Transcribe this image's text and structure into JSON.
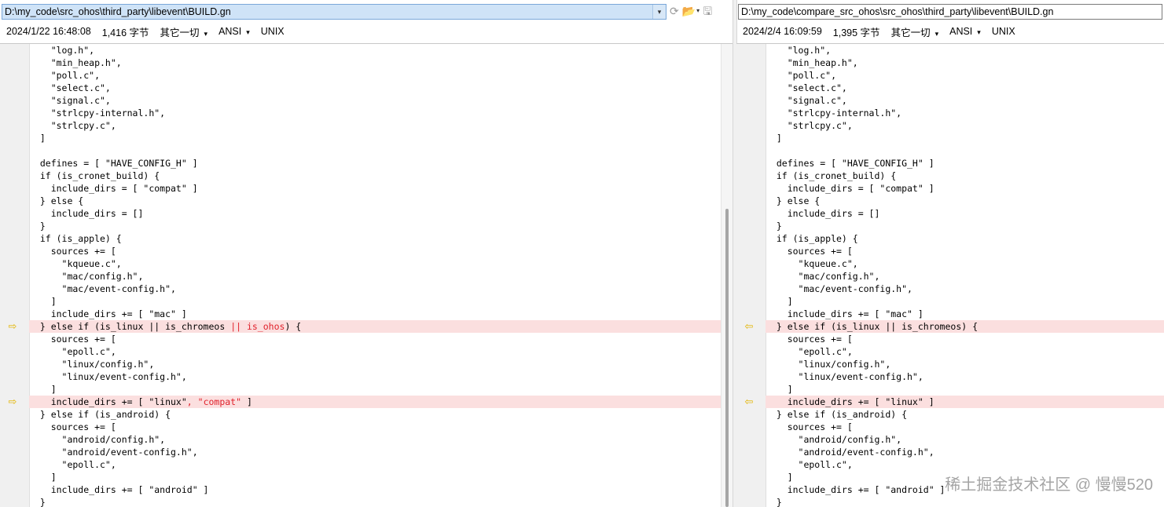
{
  "left": {
    "path": "D:\\my_code\\src_ohos\\third_party\\libevent\\BUILD.gn",
    "date": "2024/1/22 16:48:08",
    "size": "1,416 字节",
    "filter": "其它一切",
    "encoding": "ANSI",
    "line_ending": "UNIX"
  },
  "right": {
    "path": "D:\\my_code\\compare_src_ohos\\src_ohos\\third_party\\libevent\\BUILD.gn",
    "date": "2024/2/4 16:09:59",
    "size": "1,395 字节",
    "filter": "其它一切",
    "encoding": "ANSI",
    "line_ending": "UNIX"
  },
  "icons": {
    "dropdown": "▾",
    "reload": "⟳",
    "open_folder": "📂",
    "save": "🖫",
    "marker_right": "⇨",
    "marker_left": "⇦"
  },
  "watermark": "稀土掘金技术社区 @ 慢慢520",
  "left_lines": [
    {
      "segs": [
        {
          "t": "    \"log.h\","
        }
      ]
    },
    {
      "segs": [
        {
          "t": "    \"min_heap.h\","
        }
      ]
    },
    {
      "segs": [
        {
          "t": "    \"poll.c\","
        }
      ]
    },
    {
      "segs": [
        {
          "t": "    \"select.c\","
        }
      ]
    },
    {
      "segs": [
        {
          "t": "    \"signal.c\","
        }
      ]
    },
    {
      "segs": [
        {
          "t": "    \"strlcpy-internal.h\","
        }
      ]
    },
    {
      "segs": [
        {
          "t": "    \"strlcpy.c\","
        }
      ]
    },
    {
      "segs": [
        {
          "t": "  ]"
        }
      ]
    },
    {
      "segs": [
        {
          "t": ""
        }
      ]
    },
    {
      "segs": [
        {
          "t": "  defines = [ \"HAVE_CONFIG_H\" ]"
        }
      ]
    },
    {
      "segs": [
        {
          "t": "  if (is_cronet_build) {"
        }
      ]
    },
    {
      "segs": [
        {
          "t": "    include_dirs = [ \"compat\" ]"
        }
      ]
    },
    {
      "segs": [
        {
          "t": "  } else {"
        }
      ]
    },
    {
      "segs": [
        {
          "t": "    include_dirs = []"
        }
      ]
    },
    {
      "segs": [
        {
          "t": "  }"
        }
      ]
    },
    {
      "segs": [
        {
          "t": "  if (is_apple) {"
        }
      ]
    },
    {
      "segs": [
        {
          "t": "    sources += ["
        }
      ]
    },
    {
      "segs": [
        {
          "t": "      \"kqueue.c\","
        }
      ]
    },
    {
      "segs": [
        {
          "t": "      \"mac/config.h\","
        }
      ]
    },
    {
      "segs": [
        {
          "t": "      \"mac/event-config.h\","
        }
      ]
    },
    {
      "segs": [
        {
          "t": "    ]"
        }
      ]
    },
    {
      "segs": [
        {
          "t": "    include_dirs += [ \"mac\" ]"
        }
      ]
    },
    {
      "diff": true,
      "segs": [
        {
          "t": "  } else if (is_linux || is_chromeos "
        },
        {
          "t": "|| is_ohos",
          "hl": true
        },
        {
          "t": ") {"
        }
      ]
    },
    {
      "segs": [
        {
          "t": "    sources += ["
        }
      ]
    },
    {
      "segs": [
        {
          "t": "      \"epoll.c\","
        }
      ]
    },
    {
      "segs": [
        {
          "t": "      \"linux/config.h\","
        }
      ]
    },
    {
      "segs": [
        {
          "t": "      \"linux/event-config.h\","
        }
      ]
    },
    {
      "segs": [
        {
          "t": "    ]"
        }
      ]
    },
    {
      "diff": true,
      "segs": [
        {
          "t": "    include_dirs += [ \"linux\""
        },
        {
          "t": ", \"compat\"",
          "hl": true
        },
        {
          "t": " ]"
        }
      ]
    },
    {
      "segs": [
        {
          "t": "  } else if (is_android) {"
        }
      ]
    },
    {
      "segs": [
        {
          "t": "    sources += ["
        }
      ]
    },
    {
      "segs": [
        {
          "t": "      \"android/config.h\","
        }
      ]
    },
    {
      "segs": [
        {
          "t": "      \"android/event-config.h\","
        }
      ]
    },
    {
      "segs": [
        {
          "t": "      \"epoll.c\","
        }
      ]
    },
    {
      "segs": [
        {
          "t": "    ]"
        }
      ]
    },
    {
      "segs": [
        {
          "t": "    include_dirs += [ \"android\" ]"
        }
      ]
    },
    {
      "segs": [
        {
          "t": "  }"
        }
      ]
    }
  ],
  "right_lines": [
    {
      "segs": [
        {
          "t": "    \"log.h\","
        }
      ]
    },
    {
      "segs": [
        {
          "t": "    \"min_heap.h\","
        }
      ]
    },
    {
      "segs": [
        {
          "t": "    \"poll.c\","
        }
      ]
    },
    {
      "segs": [
        {
          "t": "    \"select.c\","
        }
      ]
    },
    {
      "segs": [
        {
          "t": "    \"signal.c\","
        }
      ]
    },
    {
      "segs": [
        {
          "t": "    \"strlcpy-internal.h\","
        }
      ]
    },
    {
      "segs": [
        {
          "t": "    \"strlcpy.c\","
        }
      ]
    },
    {
      "segs": [
        {
          "t": "  ]"
        }
      ]
    },
    {
      "segs": [
        {
          "t": ""
        }
      ]
    },
    {
      "segs": [
        {
          "t": "  defines = [ \"HAVE_CONFIG_H\" ]"
        }
      ]
    },
    {
      "segs": [
        {
          "t": "  if (is_cronet_build) {"
        }
      ]
    },
    {
      "segs": [
        {
          "t": "    include_dirs = [ \"compat\" ]"
        }
      ]
    },
    {
      "segs": [
        {
          "t": "  } else {"
        }
      ]
    },
    {
      "segs": [
        {
          "t": "    include_dirs = []"
        }
      ]
    },
    {
      "segs": [
        {
          "t": "  }"
        }
      ]
    },
    {
      "segs": [
        {
          "t": "  if (is_apple) {"
        }
      ]
    },
    {
      "segs": [
        {
          "t": "    sources += ["
        }
      ]
    },
    {
      "segs": [
        {
          "t": "      \"kqueue.c\","
        }
      ]
    },
    {
      "segs": [
        {
          "t": "      \"mac/config.h\","
        }
      ]
    },
    {
      "segs": [
        {
          "t": "      \"mac/event-config.h\","
        }
      ]
    },
    {
      "segs": [
        {
          "t": "    ]"
        }
      ]
    },
    {
      "segs": [
        {
          "t": "    include_dirs += [ \"mac\" ]"
        }
      ]
    },
    {
      "diff": true,
      "segs": [
        {
          "t": "  } else if (is_linux || is_chromeos) {"
        }
      ]
    },
    {
      "segs": [
        {
          "t": "    sources += ["
        }
      ]
    },
    {
      "segs": [
        {
          "t": "      \"epoll.c\","
        }
      ]
    },
    {
      "segs": [
        {
          "t": "      \"linux/config.h\","
        }
      ]
    },
    {
      "segs": [
        {
          "t": "      \"linux/event-config.h\","
        }
      ]
    },
    {
      "segs": [
        {
          "t": "    ]"
        }
      ]
    },
    {
      "diff": true,
      "segs": [
        {
          "t": "    include_dirs += [ \"linux\" ]"
        }
      ]
    },
    {
      "segs": [
        {
          "t": "  } else if (is_android) {"
        }
      ]
    },
    {
      "segs": [
        {
          "t": "    sources += ["
        }
      ]
    },
    {
      "segs": [
        {
          "t": "      \"android/config.h\","
        }
      ]
    },
    {
      "segs": [
        {
          "t": "      \"android/event-config.h\","
        }
      ]
    },
    {
      "segs": [
        {
          "t": "      \"epoll.c\","
        }
      ]
    },
    {
      "segs": [
        {
          "t": "    ]"
        }
      ]
    },
    {
      "segs": [
        {
          "t": "    include_dirs += [ \"android\" ]"
        }
      ]
    },
    {
      "segs": [
        {
          "t": "  }"
        }
      ]
    }
  ]
}
